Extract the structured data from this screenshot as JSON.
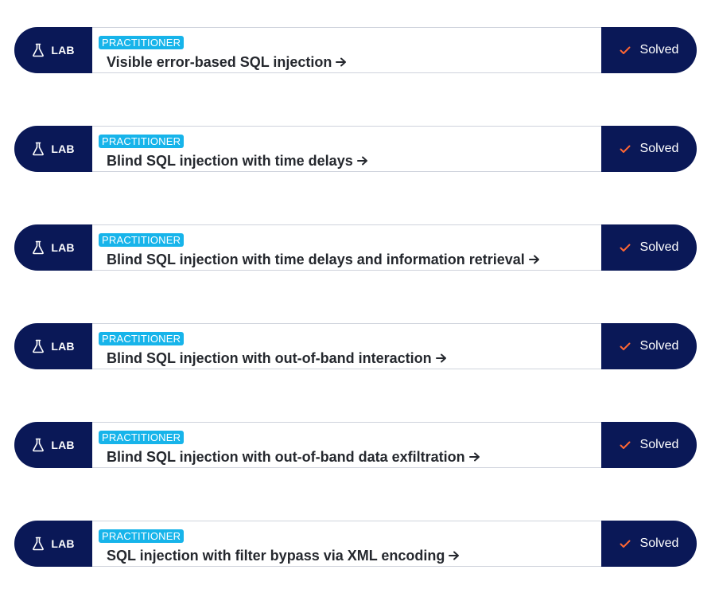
{
  "tag_label": "LAB",
  "colors": {
    "navy": "#0a1857",
    "badge": "#17b4ea",
    "check": "#ff6633"
  },
  "labs": [
    {
      "level": "PRACTITIONER",
      "title": "Visible error-based SQL injection",
      "status": "Solved"
    },
    {
      "level": "PRACTITIONER",
      "title": "Blind SQL injection with time delays",
      "status": "Solved"
    },
    {
      "level": "PRACTITIONER",
      "title": "Blind SQL injection with time delays and information retrieval",
      "status": "Solved"
    },
    {
      "level": "PRACTITIONER",
      "title": "Blind SQL injection with out-of-band interaction",
      "status": "Solved"
    },
    {
      "level": "PRACTITIONER",
      "title": "Blind SQL injection with out-of-band data exfiltration",
      "status": "Solved"
    },
    {
      "level": "PRACTITIONER",
      "title": "SQL injection with filter bypass via XML encoding",
      "status": "Solved"
    }
  ]
}
